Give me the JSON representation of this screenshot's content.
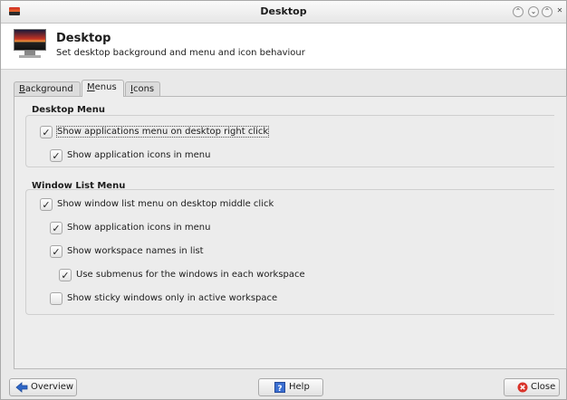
{
  "window": {
    "title": "Desktop",
    "controls": {
      "minimize": "⌃",
      "restore": "⌄",
      "maximize": "⌃",
      "close": "✕"
    }
  },
  "header": {
    "title": "Desktop",
    "subtitle": "Set desktop background and menu and icon behaviour"
  },
  "tabs": [
    {
      "label_u": "B",
      "label_rest": "ackground",
      "active": false
    },
    {
      "label_u": "M",
      "label_rest": "enus",
      "active": true
    },
    {
      "label_u": "I",
      "label_rest": "cons",
      "active": false
    }
  ],
  "desktop_menu": {
    "title": "Desktop Menu",
    "options": [
      {
        "label": "Show applications menu on desktop right click",
        "checked": true
      },
      {
        "label": "Show application icons in menu",
        "checked": true
      }
    ]
  },
  "window_list_menu": {
    "title": "Window List Menu",
    "options": [
      {
        "label": "Show window list menu on desktop middle click",
        "checked": true
      },
      {
        "label": "Show application icons in menu",
        "checked": true
      },
      {
        "label": "Show workspace names in list",
        "checked": true
      },
      {
        "label": "Use submenus for the windows in each workspace",
        "checked": true
      },
      {
        "label": "Show sticky windows only in active workspace",
        "checked": false
      }
    ]
  },
  "checkmark": "✓",
  "buttons": {
    "overview": {
      "label": "Overview",
      "icon": "back-arrow-icon"
    },
    "help": {
      "label": "Help",
      "icon": "help-icon"
    },
    "close": {
      "label": "Close",
      "icon": "close-icon"
    }
  },
  "colors": {
    "close_red": "#d9342b",
    "help_blue": "#3b6fd1",
    "overview_blue": "#2f67c7"
  }
}
